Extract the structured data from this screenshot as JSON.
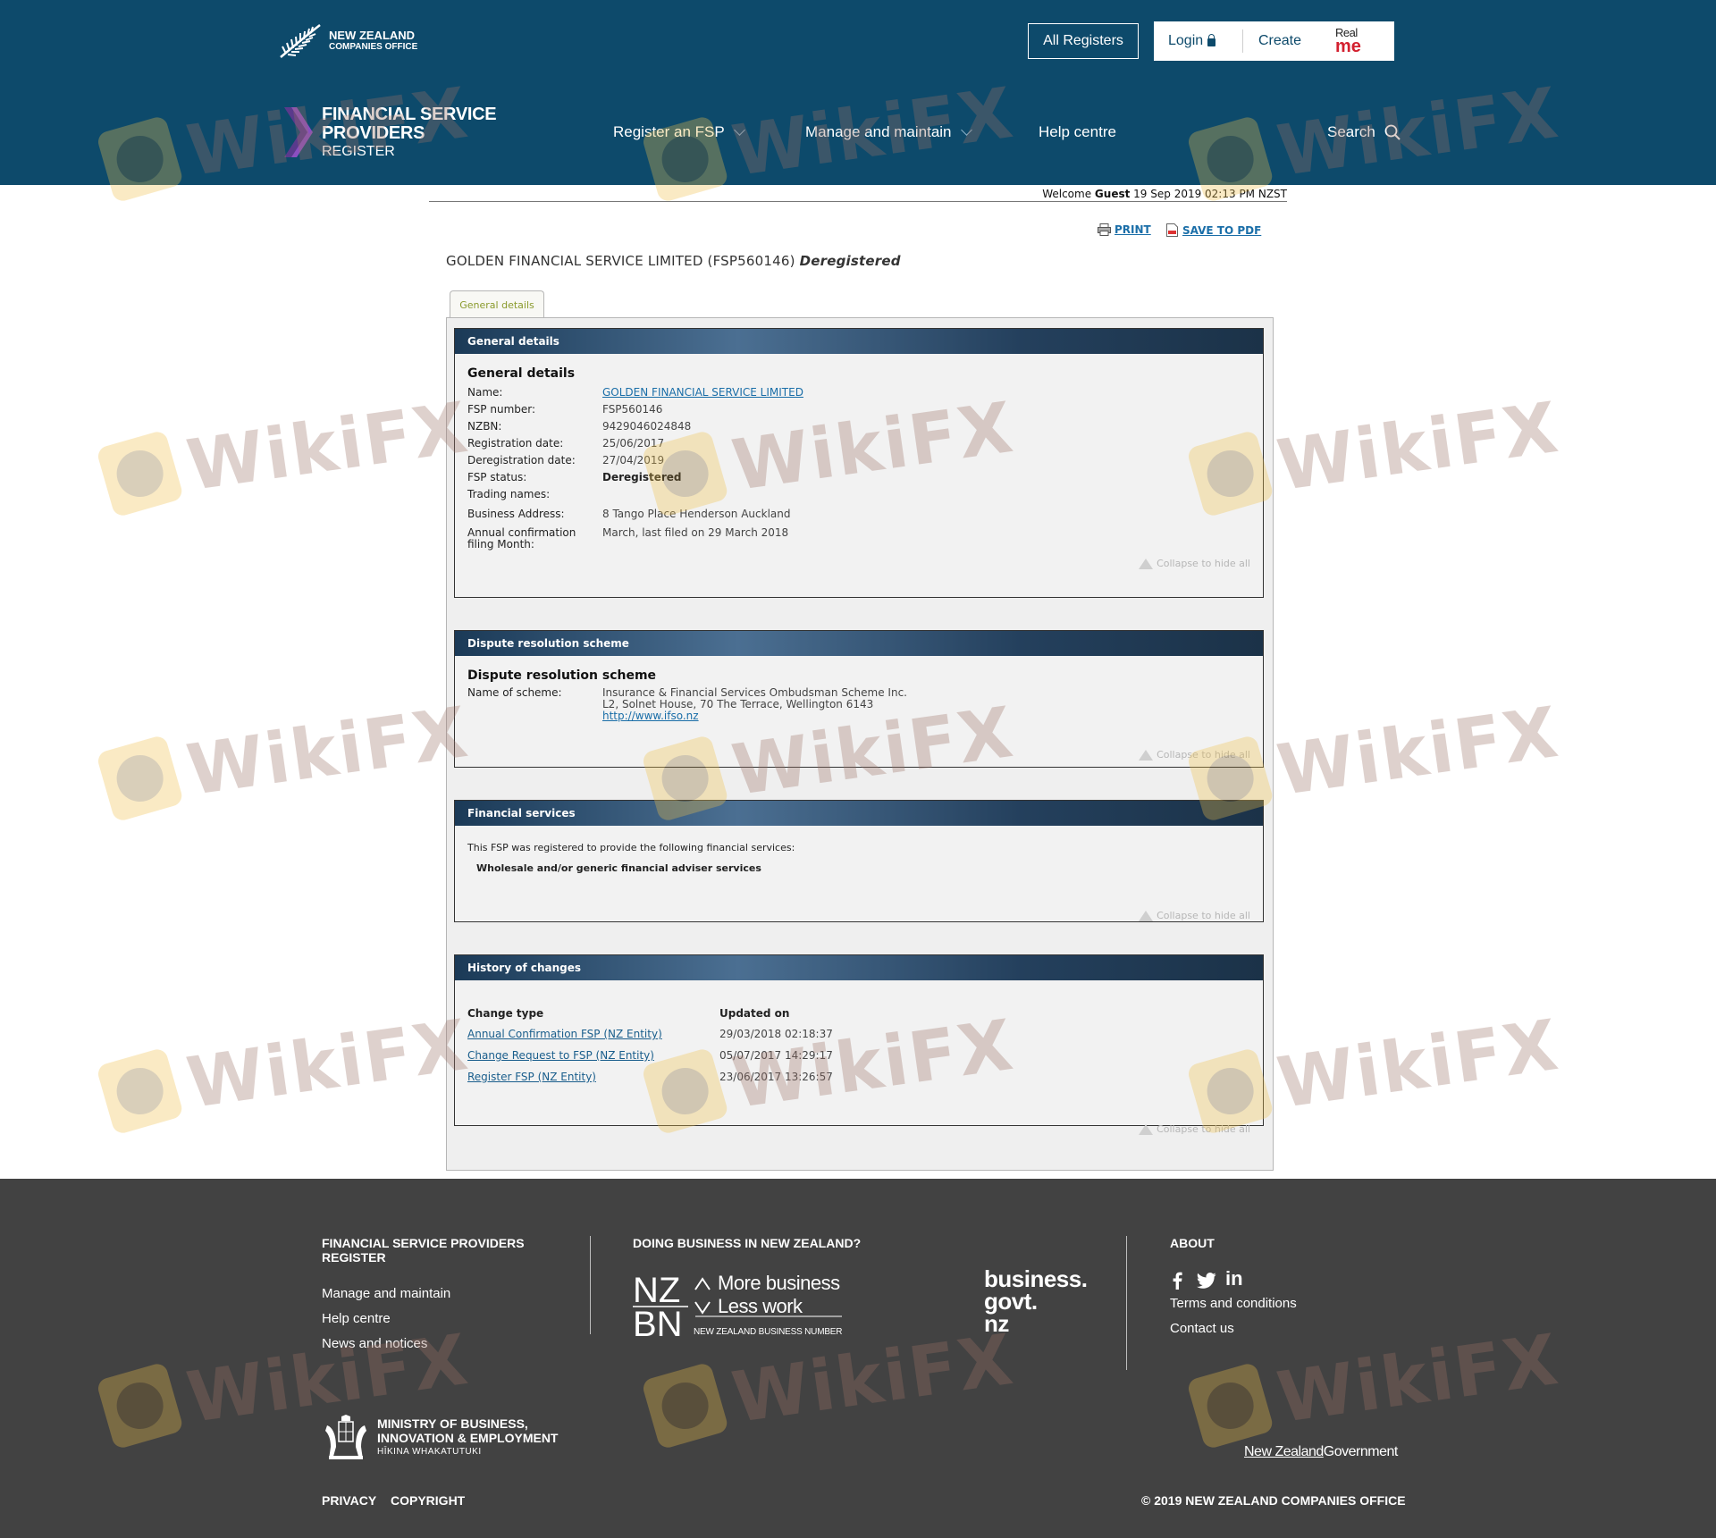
{
  "header": {
    "nz_logo_line1": "NEW ZEALAND",
    "nz_logo_line2": "COMPANIES OFFICE",
    "all_registers": "All Registers",
    "login": "Login",
    "create": "Create",
    "realme_top": "Real",
    "realme_bottom": "me"
  },
  "nav": {
    "logo_line1": "FINANCIAL SERVICE",
    "logo_line2": "PROVIDERS",
    "logo_line3": "REGISTER",
    "items": [
      {
        "label": "Register an FSP"
      },
      {
        "label": "Manage and maintain"
      },
      {
        "label": "Help centre"
      }
    ],
    "search": "Search"
  },
  "welcome": {
    "prefix": "Welcome",
    "user": "Guest",
    "datetime": "19 Sep 2019 02:13 PM NZST"
  },
  "actions": {
    "print": "PRINT",
    "save_pdf": "SAVE TO PDF"
  },
  "entity": {
    "name_code": "GOLDEN FINANCIAL SERVICE LIMITED (FSP560146)",
    "status": "Deregistered"
  },
  "tab": {
    "label": "General details"
  },
  "collapse_label": "Collapse to hide all",
  "general": {
    "head": "General details",
    "title": "General details",
    "fields": [
      {
        "k": "Name:",
        "v": "GOLDEN FINANCIAL SERVICE LIMITED"
      },
      {
        "k": "FSP number:",
        "v": "FSP560146"
      },
      {
        "k": "NZBN:",
        "v": "9429046024848"
      },
      {
        "k": "Registration date:",
        "v": "25/06/2017"
      },
      {
        "k": "Deregistration date:",
        "v": "27/04/2019"
      },
      {
        "k": "FSP status:",
        "v": "Deregistered"
      },
      {
        "k": "Trading names:",
        "v": ""
      },
      {
        "k": "Business Address:",
        "v": "8 Tango Place Henderson Auckland"
      },
      {
        "k": "Annual confirmation filing Month:",
        "v": "March, last filed on 29 March 2018"
      }
    ]
  },
  "dispute": {
    "head": "Dispute resolution scheme",
    "title": "Dispute resolution scheme",
    "label": "Name of scheme:",
    "line1": "Insurance & Financial Services Ombudsman Scheme Inc.",
    "line2": "L2, Solnet House, 70 The Terrace, Wellington 6143",
    "url": "http://www.ifso.nz"
  },
  "services": {
    "head": "Financial services",
    "intro": "This FSP was registered to provide the following financial services:",
    "item": "Wholesale and/or generic financial adviser services"
  },
  "history": {
    "head": "History of changes",
    "col1": "Change type",
    "col2": "Updated on",
    "rows": [
      {
        "type": "Annual Confirmation FSP (NZ Entity)",
        "date": "29/03/2018 02:18:37"
      },
      {
        "type": "Change Request to FSP (NZ Entity)",
        "date": "05/07/2017 14:29:17"
      },
      {
        "type": "Register FSP (NZ Entity)",
        "date": "23/06/2017 13:26:57"
      }
    ]
  },
  "footer": {
    "col1_head": "FINANCIAL SERVICE PROVIDERS REGISTER",
    "col1_links": [
      "Manage and maintain",
      "Help centre",
      "News and notices"
    ],
    "col2_head": "DOING BUSINESS IN NEW ZEALAND?",
    "nzbn_line1": "More business",
    "nzbn_line2": "Less work",
    "nzbn_sub": "NEW ZEALAND BUSINESS NUMBER",
    "bgn_1": "business.",
    "bgn_2": "govt.",
    "bgn_3": "nz",
    "col3_head": "ABOUT",
    "col3_links": [
      "Terms and conditions",
      "Contact us"
    ],
    "mbie_1": "MINISTRY OF BUSINESS,",
    "mbie_2": "INNOVATION & EMPLOYMENT",
    "mbie_3": "HĪKINA WHAKATUTUKI",
    "nzgov_1": "New Zealand",
    "nzgov_2": "Government",
    "privacy": "PRIVACY",
    "copyright": "COPYRIGHT",
    "copyright_notice": "© 2019 NEW ZEALAND COMPANIES OFFICE"
  },
  "watermark": {
    "text": "WikiFX"
  },
  "colors": {
    "brand": "#0d4a6b",
    "footer": "#424242",
    "link": "#1a5e8c",
    "section_head": "#1b3a57"
  }
}
